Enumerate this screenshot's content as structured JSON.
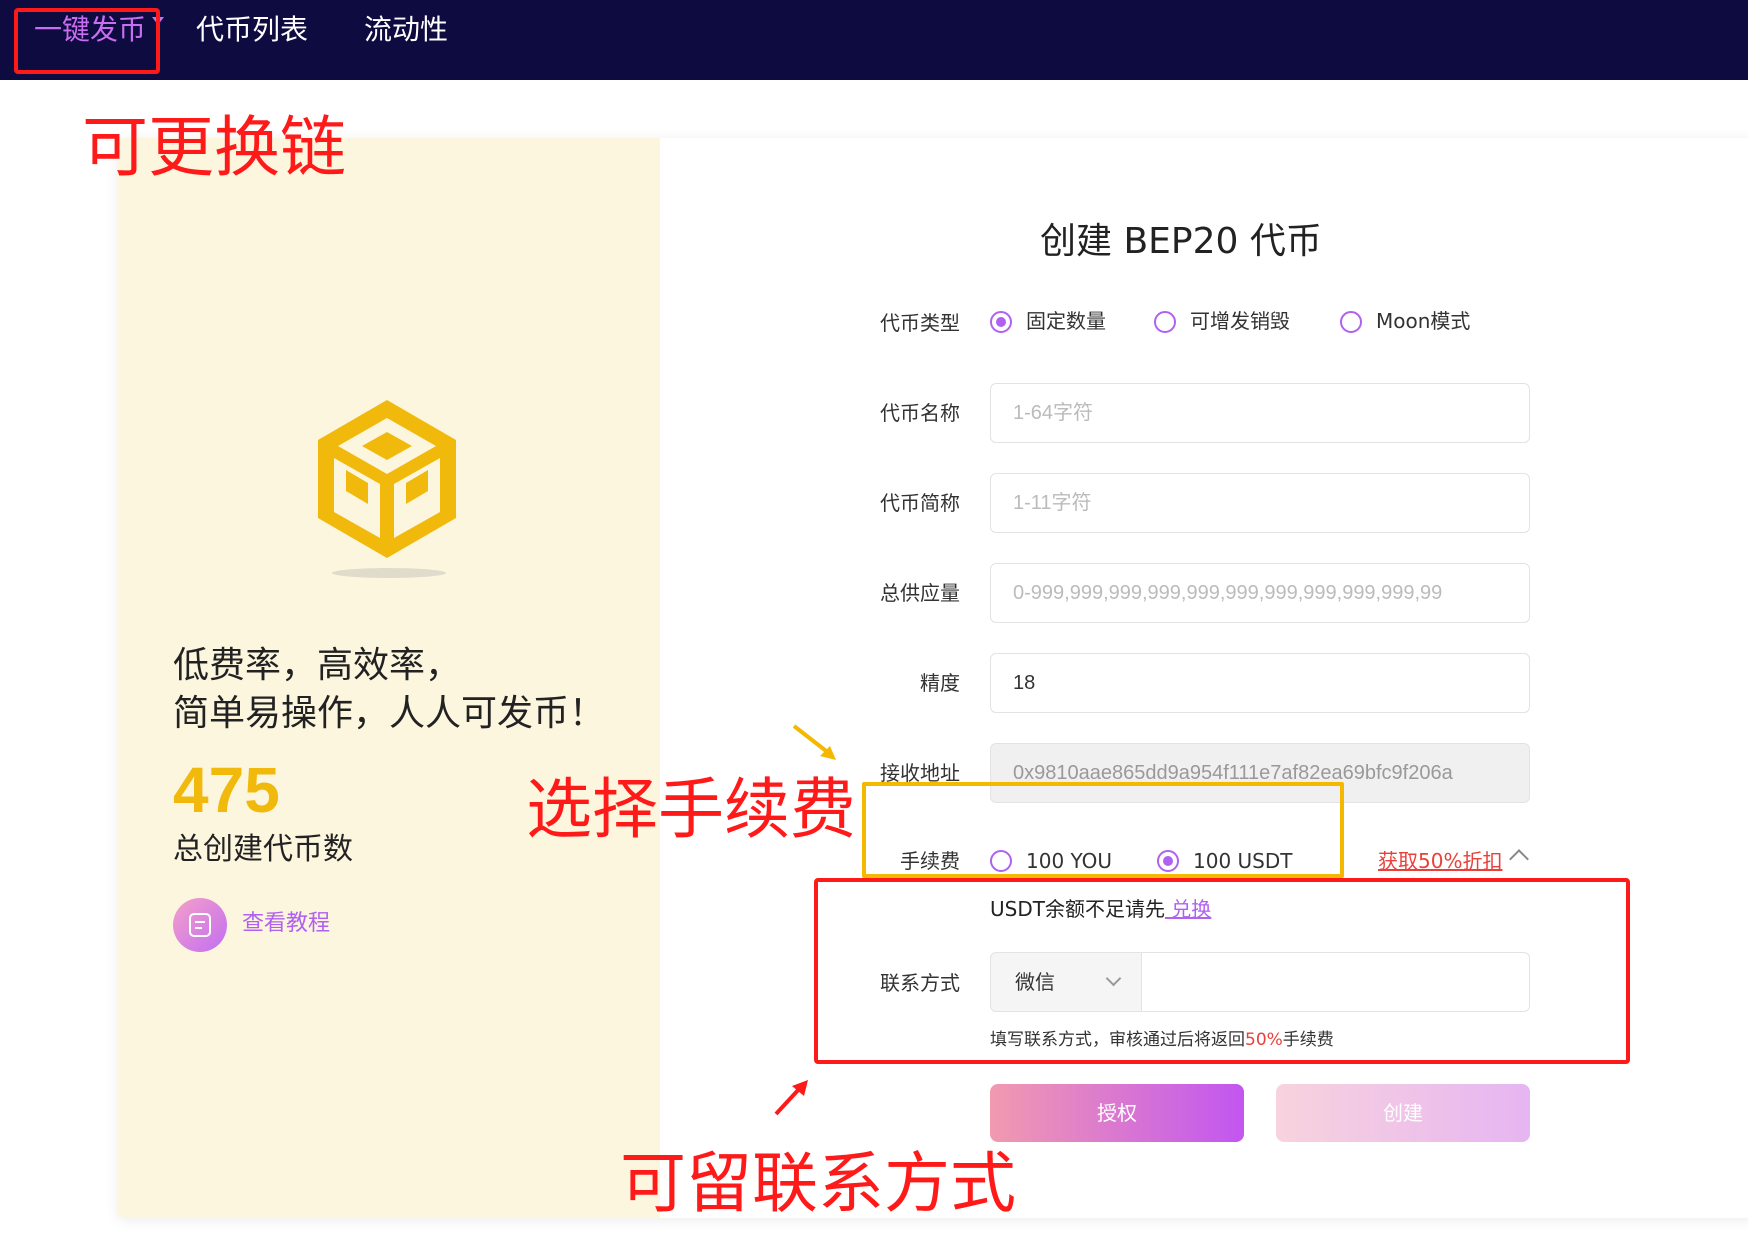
{
  "nav": {
    "items": [
      {
        "label": "一键发币",
        "active": true
      },
      {
        "label": "代币列表",
        "active": false
      },
      {
        "label": "流动性",
        "active": false
      }
    ]
  },
  "left": {
    "slogan_line1": "低费率，高效率，",
    "slogan_line2": "简单易操作，人人可发币！",
    "count": "475",
    "count_label": "总创建代币数",
    "tutorial_label": "查看教程"
  },
  "form": {
    "title": "创建 BEP20 代币",
    "token_type": {
      "label": "代币类型",
      "options": [
        "固定数量",
        "可增发销毁",
        "Moon模式"
      ],
      "selected": "固定数量"
    },
    "name": {
      "label": "代币名称",
      "placeholder": "1-64字符"
    },
    "symbol": {
      "label": "代币简称",
      "placeholder": "1-11字符"
    },
    "supply": {
      "label": "总供应量",
      "placeholder": "0-999,999,999,999,999,999,999,999,999,999,99"
    },
    "decimals": {
      "label": "精度",
      "value": "18"
    },
    "receiver": {
      "label": "接收地址",
      "value": "0x9810aae865dd9a954f111e7af82ea69bfc9f206a"
    },
    "fee": {
      "label": "手续费",
      "options": [
        "100 YOU",
        "100 USDT"
      ],
      "selected": "100 USDT",
      "discount_link": "获取50%折扣"
    },
    "usdt_note": "USDT余额不足请先",
    "usdt_link": " 兑换",
    "contact": {
      "label": "联系方式",
      "select_value": "微信",
      "input_value": ""
    },
    "contact_hint_before": "填写联系方式，审核通过后将返回",
    "contact_hint_highlight": "50%",
    "contact_hint_after": "手续费",
    "approve_label": "授权",
    "create_label": "创建"
  },
  "annotations": {
    "chain": "可更换链",
    "fee": "选择手续费",
    "contact": "可留联系方式"
  },
  "colors": {
    "nav_bg": "#0e0b40",
    "accent_purple": "#b061f0",
    "bnb_yellow": "#f0b90b",
    "left_panel_bg": "#fcf6df",
    "annotation_red": "#ff1a1a",
    "annotation_yellow": "#f5b800"
  }
}
